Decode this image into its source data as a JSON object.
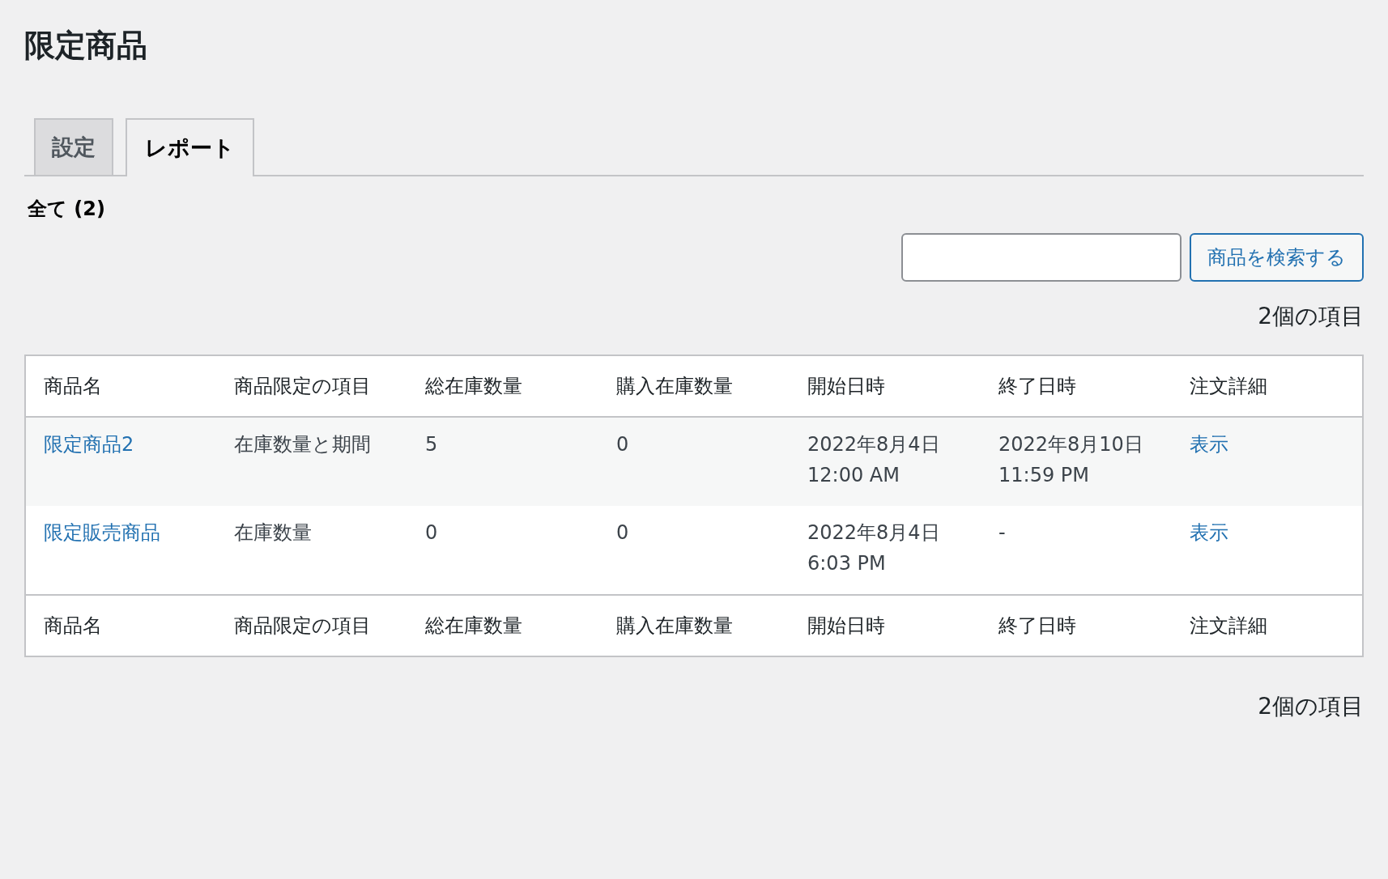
{
  "title": "限定商品",
  "tabs": [
    {
      "label": "設定",
      "selected": false
    },
    {
      "label": "レポート",
      "selected": true
    }
  ],
  "filter": {
    "label": "全て (2)"
  },
  "search": {
    "button": "商品を検索する"
  },
  "item_count_top": "2個の項目",
  "table": {
    "columns": [
      "商品名",
      "商品限定の項目",
      "総在庫数量",
      "購入在庫数量",
      "開始日時",
      "終了日時",
      "注文詳細"
    ],
    "rows": [
      {
        "name": "限定商品2",
        "limit_type": "在庫数量と期間",
        "total_stock": "5",
        "purchased_stock": "0",
        "start": [
          "2022年8月4日",
          "12:00 AM"
        ],
        "end": [
          "2022年8月10日",
          "11:59 PM"
        ],
        "details": "表示"
      },
      {
        "name": "限定販売商品",
        "limit_type": "在庫数量",
        "total_stock": "0",
        "purchased_stock": "0",
        "start": [
          "2022年8月4日",
          "6:03 PM"
        ],
        "end": [
          "-"
        ],
        "details": "表示"
      }
    ],
    "footer_columns": [
      "商品名",
      "商品限定の項目",
      "総在庫数量",
      "購入在庫数量",
      "開始日時",
      "終了日時",
      "注文詳細"
    ]
  },
  "item_count_bottom": "2個の項目"
}
